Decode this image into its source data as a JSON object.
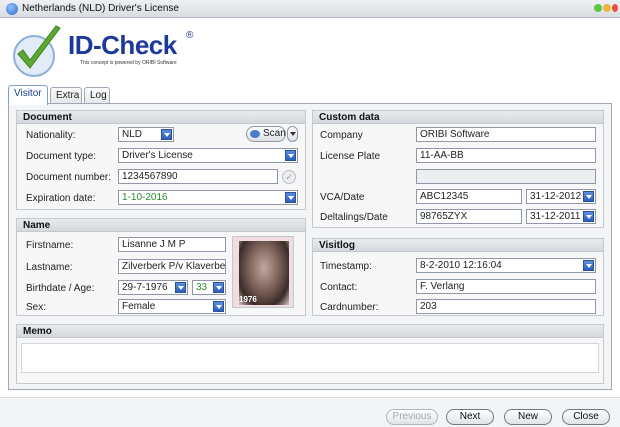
{
  "window": {
    "title": "Netherlands (NLD) Driver's License",
    "colors": {
      "accent": "#1d3a9b",
      "check_green": "#5da832"
    }
  },
  "logo": {
    "text": "ID-Check",
    "reg": "®",
    "subtitle": "This concept is powered by ORIBI Software"
  },
  "tabs": [
    {
      "label": "Visitor",
      "active": true
    },
    {
      "label": "Extra"
    },
    {
      "label": "Log"
    }
  ],
  "document": {
    "header": "Document",
    "nationality_label": "Nationality:",
    "nationality_value": "NLD",
    "scan_label": "Scan",
    "doctype_label": "Document type:",
    "doctype_value": "Driver's License",
    "docnumber_label": "Document number:",
    "docnumber_value": "1234567890",
    "expiration_label": "Expiration date:",
    "expiration_value": "1-10-2016"
  },
  "name": {
    "header": "Name",
    "firstname_label": "Firstname:",
    "firstname_value": "Lisanne J M P",
    "lastname_label": "Lastname:",
    "lastname_value": "Zilverberk P/v Klaverbe",
    "birthdate_label": "Birthdate / Age:",
    "birthdate_value": "29-7-1976",
    "age_value": "33",
    "sex_label": "Sex:",
    "sex_value": "Female",
    "photo_year": "1976"
  },
  "custom": {
    "header": "Custom data",
    "company_label": "Company",
    "company_value": "ORIBI Software",
    "plate_label": "License Plate",
    "plate_value": "11-AA-BB",
    "extra_value": "",
    "vca_label": "VCA/Date",
    "vca_value": "ABC12345",
    "vca_date": "31-12-2012",
    "delta_label": "Deltalings/Date",
    "delta_value": "98765ZYX",
    "delta_date": "31-12-2011"
  },
  "visitlog": {
    "header": "Visitlog",
    "timestamp_label": "Timestamp:",
    "timestamp_value": "8-2-2010 12:16:04",
    "contact_label": "Contact:",
    "contact_value": "F. Verlang",
    "card_label": "Cardnumber:",
    "card_value": "203"
  },
  "memo": {
    "header": "Memo",
    "value": ""
  },
  "buttons": {
    "previous": "Previous",
    "next": "Next",
    "new": "New",
    "close": "Close"
  }
}
